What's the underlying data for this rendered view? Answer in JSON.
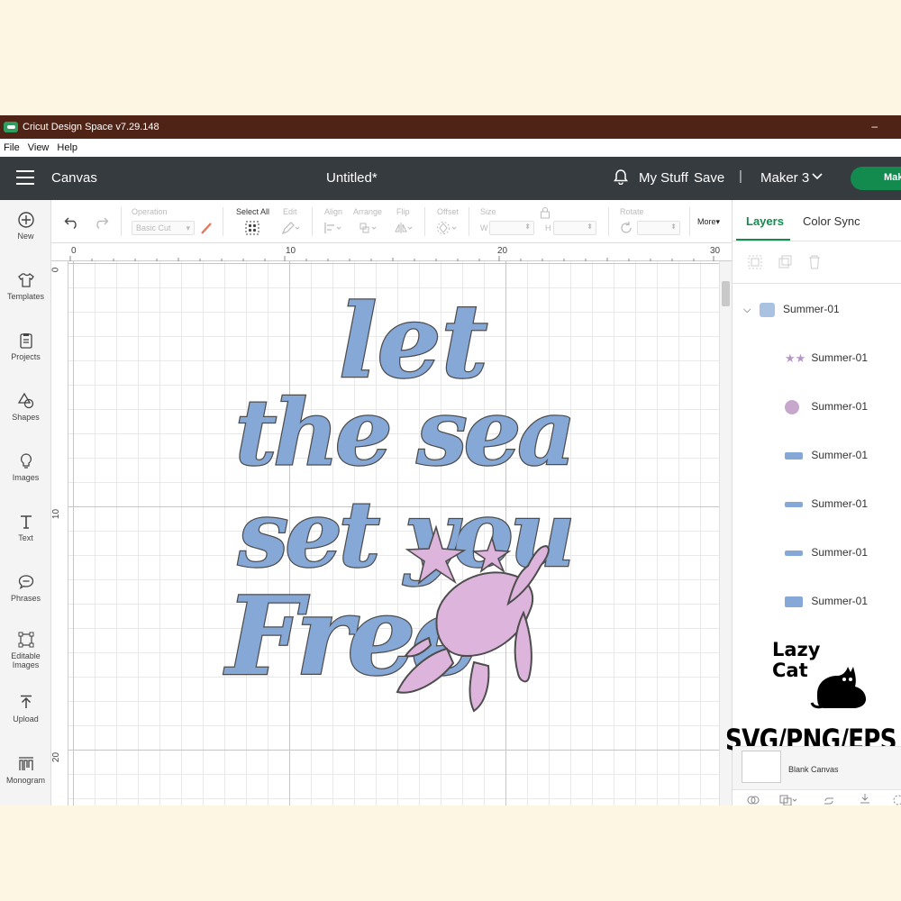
{
  "window": {
    "title": "Cricut Design Space  v7.29.148",
    "minimize": "–"
  },
  "menu": [
    "File",
    "View",
    "Help"
  ],
  "header": {
    "canvas": "Canvas",
    "doc_title": "Untitled*",
    "my_stuff": "My Stuff",
    "save": "Save",
    "separator": "|",
    "machine": "Maker 3",
    "make": "Mak"
  },
  "sidebar": [
    {
      "label": "New",
      "icon": "plus-circle-icon"
    },
    {
      "label": "Templates",
      "icon": "shirt-icon"
    },
    {
      "label": "Projects",
      "icon": "clipboard-icon"
    },
    {
      "label": "Shapes",
      "icon": "shapes-icon"
    },
    {
      "label": "Images",
      "icon": "lightbulb-icon"
    },
    {
      "label": "Text",
      "icon": "text-icon"
    },
    {
      "label": "Phrases",
      "icon": "speech-bubble-icon"
    },
    {
      "label": "Editable",
      "label2": "Images",
      "icon": "editable-images-icon"
    },
    {
      "label": "Upload",
      "icon": "upload-icon"
    },
    {
      "label": "Monogram",
      "icon": "monogram-icon"
    }
  ],
  "toolbar": {
    "operation": "Operation",
    "operation_value": "Basic Cut",
    "select_all": "Select All",
    "edit": "Edit",
    "align": "Align",
    "arrange": "Arrange",
    "flip": "Flip",
    "offset": "Offset",
    "size": "Size",
    "w": "W",
    "h": "H",
    "rotate": "Rotate",
    "more": "More▾"
  },
  "ruler": {
    "h": [
      "0",
      "10",
      "20",
      "30"
    ],
    "v": [
      "0",
      "10",
      "20"
    ]
  },
  "design": {
    "lines": [
      "let",
      "the sea",
      "set you",
      "Free"
    ],
    "text_color": "#86a8d6",
    "outline_color": "#4d4d4d",
    "accent_color": "#ddb4dc"
  },
  "panel": {
    "tabs": [
      "Layers",
      "Color Sync"
    ],
    "group": "Summer-01",
    "layers": [
      "Summer-01",
      "Summer-01",
      "Summer-01",
      "Summer-01",
      "Summer-01",
      "Summer-01"
    ],
    "blank_canvas": "Blank Canvas"
  },
  "watermark": {
    "line1": "Lazy",
    "line2": "Cat",
    "formats": "SVG/PNG/EPS"
  },
  "colors": {
    "titlebar": "#4f2417",
    "header": "#363b40",
    "accent_green": "#138a4e",
    "page_bg": "#fdf6e3"
  }
}
